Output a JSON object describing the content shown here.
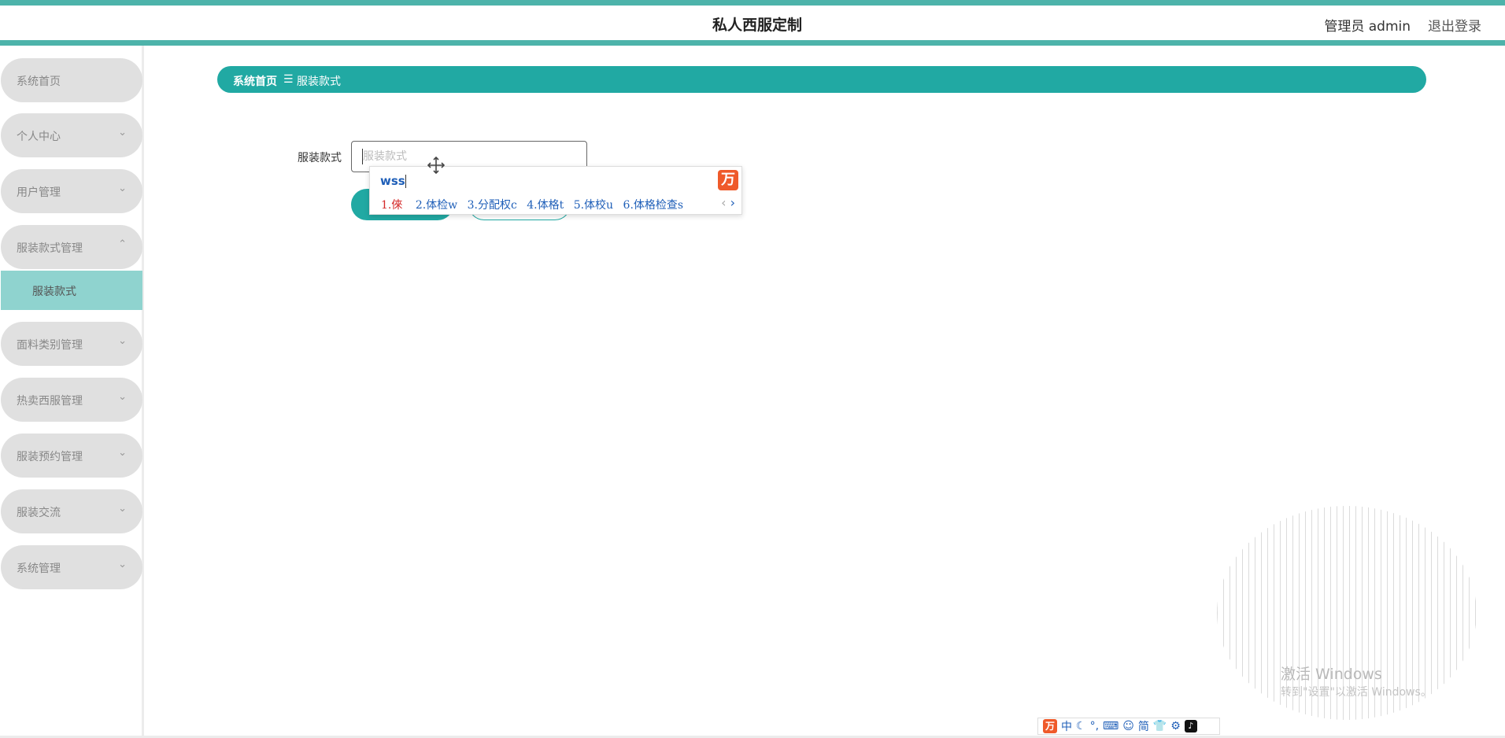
{
  "header": {
    "title": "私人西服定制",
    "user_label": "管理员 admin",
    "logout_label": "退出登录"
  },
  "sidebar": {
    "items": [
      {
        "label": "系统首页"
      },
      {
        "label": "个人中心",
        "chevron": "⌄"
      },
      {
        "label": "用户管理",
        "chevron": "⌄"
      },
      {
        "label": "服装款式管理",
        "chevron": "⌃"
      },
      {
        "label": "面料类别管理",
        "chevron": "⌄"
      },
      {
        "label": "热卖西服管理",
        "chevron": "⌄"
      },
      {
        "label": "服装预约管理",
        "chevron": "⌄"
      },
      {
        "label": "服装交流",
        "chevron": "⌄"
      },
      {
        "label": "系统管理",
        "chevron": "⌄"
      }
    ],
    "submenu": [
      {
        "label": "服装款式"
      }
    ]
  },
  "breadcrumb": {
    "home": "系统首页",
    "separator": "☰",
    "current": "服装款式"
  },
  "form": {
    "label": "服装款式",
    "placeholder": "服装款式"
  },
  "ime": {
    "input": "wss",
    "logo": "万",
    "candidates": [
      "1.倈",
      "2.体检w",
      "3.分配权c",
      "4.体格t",
      "5.体校u",
      "6.体格检查s"
    ],
    "nav_prev": "‹",
    "nav_next": "›"
  },
  "ime_toolbar": {
    "logo": "万",
    "items": [
      "中",
      "☾",
      "°,",
      "⌨",
      "☺",
      "简",
      "👕",
      "⚙"
    ],
    "tiktok": "♪"
  },
  "watermark": {
    "title": "激活 Windows",
    "subtitle": "转到\"设置\"以激活 Windows。"
  },
  "colors": {
    "accent": "#21a9a3",
    "stripe": "#4db3aa",
    "submenu_active": "#8fd3cf",
    "menu_bg": "#e0e0e0",
    "ime_brand": "#ef5a2a"
  }
}
